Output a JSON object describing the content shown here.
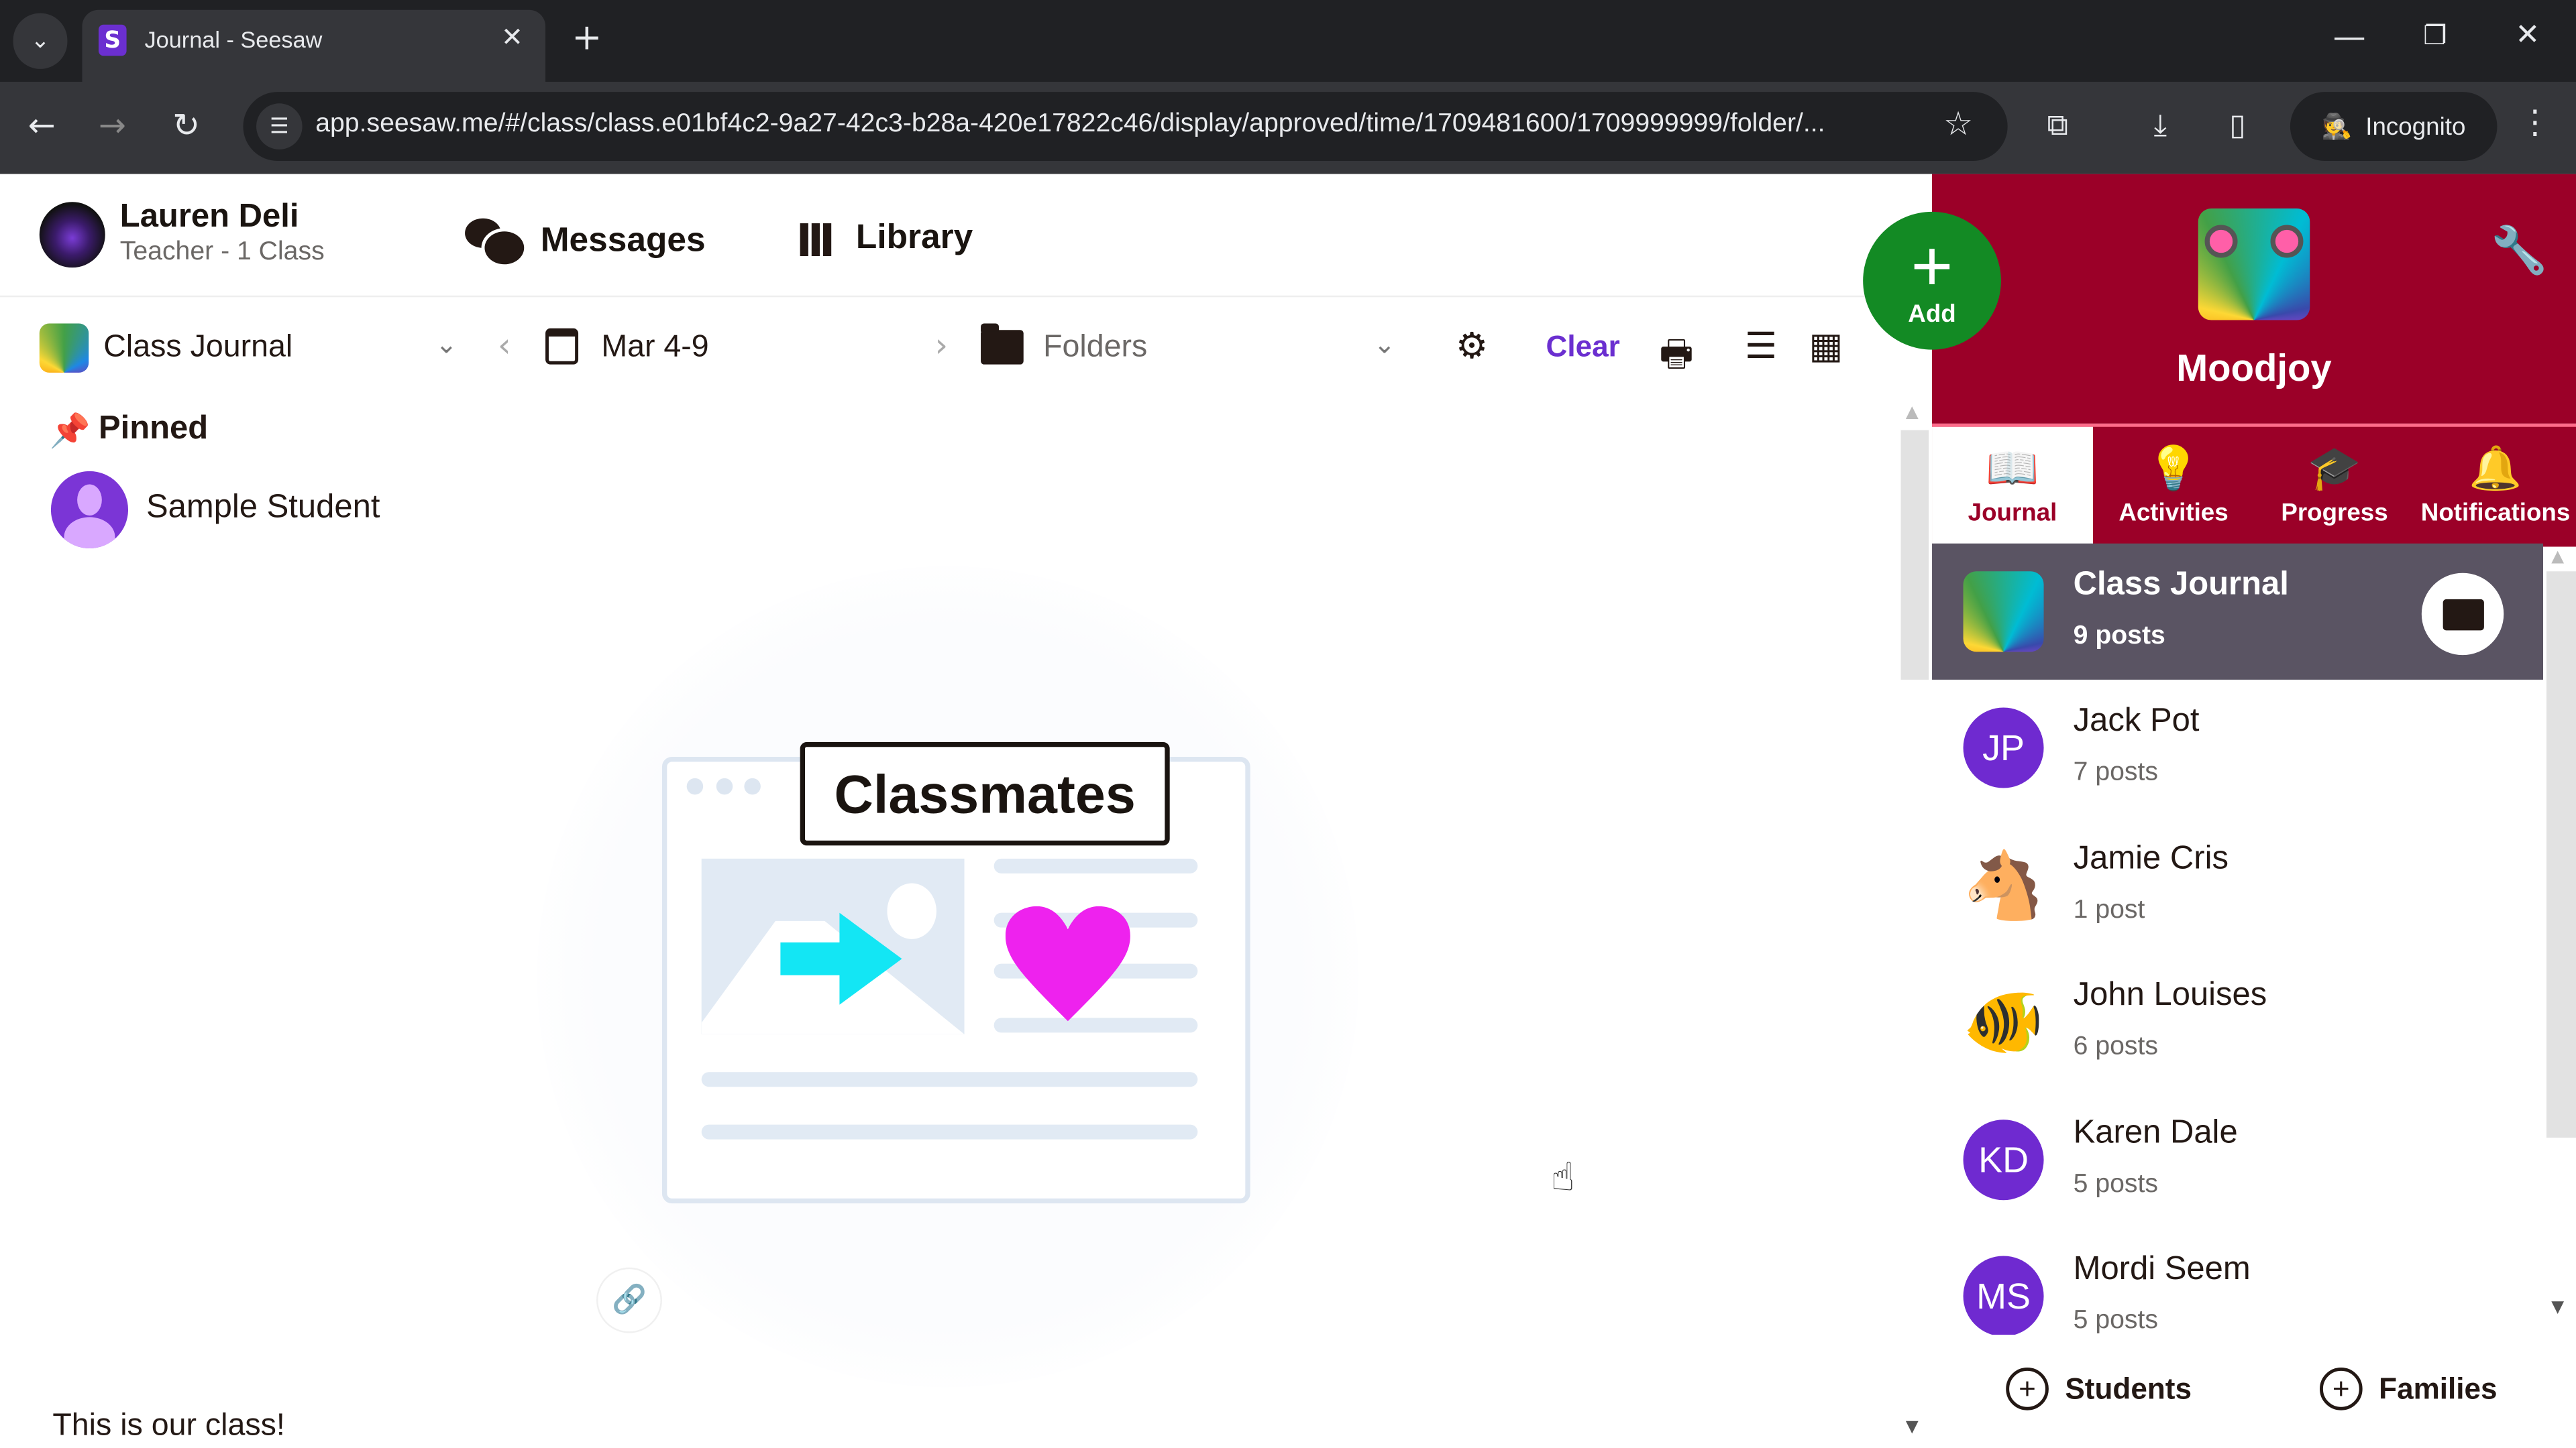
{
  "browser": {
    "tab_title": "Journal - Seesaw",
    "tab_favicon": "S",
    "url": "app.seesaw.me/#/class/class.e01bf4c2-9a27-42c3-b28a-420e17822c46/display/approved/time/1709481600/1709999999/folder/...",
    "profile_label": "Incognito",
    "icons": {
      "tab_menu": "⌄",
      "close": "✕",
      "new_tab": "+",
      "minimize": "—",
      "restore": "❐",
      "window_close": "✕",
      "back": "←",
      "forward": "→",
      "reload": "↻",
      "site_info": "☰",
      "star": "☆",
      "extensions": "⧉",
      "download": "⤓",
      "side_panel": "▯",
      "incognito": "🕵",
      "menu": "⋮"
    }
  },
  "header": {
    "user_name": "Lauren Deli",
    "user_role": "Teacher - 1 Class",
    "messages_label": "Messages",
    "library_label": "Library"
  },
  "filters": {
    "journal_label": "Class Journal",
    "date_range": "Mar 4-9",
    "folders_placeholder": "Folders",
    "clear_label": "Clear",
    "icons": {
      "chevron_down": "⌄",
      "prev": "‹",
      "next": "›",
      "sliders": "⚙",
      "print": "🖶",
      "list": "☰",
      "calendar": "▦"
    }
  },
  "pinned": {
    "label": "Pinned",
    "pin_icon": "📌",
    "student_name": "Sample Student"
  },
  "post": {
    "illustration_label": "Classmates",
    "link_icon": "🔗",
    "caption": "This is our class!",
    "cursor_icon": "☝"
  },
  "right_panel": {
    "add_label": "Add",
    "add_icon": "+",
    "class_name": "Moodjoy",
    "settings_icon": "🔧",
    "accent_color": "#9b0028",
    "tabs": [
      {
        "label": "Journal",
        "icon": "📖",
        "active": true
      },
      {
        "label": "Activities",
        "icon": "💡",
        "active": false
      },
      {
        "label": "Progress",
        "icon": "🎓",
        "active": false
      },
      {
        "label": "Notifications",
        "icon": "🔔",
        "active": false
      }
    ],
    "list": [
      {
        "name": "Class Journal",
        "count": "9 posts",
        "avatar": "",
        "type": "logo",
        "selected": true
      },
      {
        "name": "Jack Pot",
        "count": "7 posts",
        "avatar": "JP",
        "type": "initials",
        "selected": false
      },
      {
        "name": "Jamie Cris",
        "count": "1 post",
        "avatar": "🐴",
        "type": "emoji",
        "selected": false
      },
      {
        "name": "John Louises",
        "count": "6 posts",
        "avatar": "🐠",
        "type": "emoji",
        "selected": false
      },
      {
        "name": "Karen Dale",
        "count": "5 posts",
        "avatar": "KD",
        "type": "initials",
        "selected": false
      },
      {
        "name": "Mordi Seem",
        "count": "5 posts",
        "avatar": "MS",
        "type": "initials",
        "selected": false
      }
    ],
    "footer": {
      "students_label": "Students",
      "families_label": "Families",
      "plus_icon": "+"
    }
  }
}
